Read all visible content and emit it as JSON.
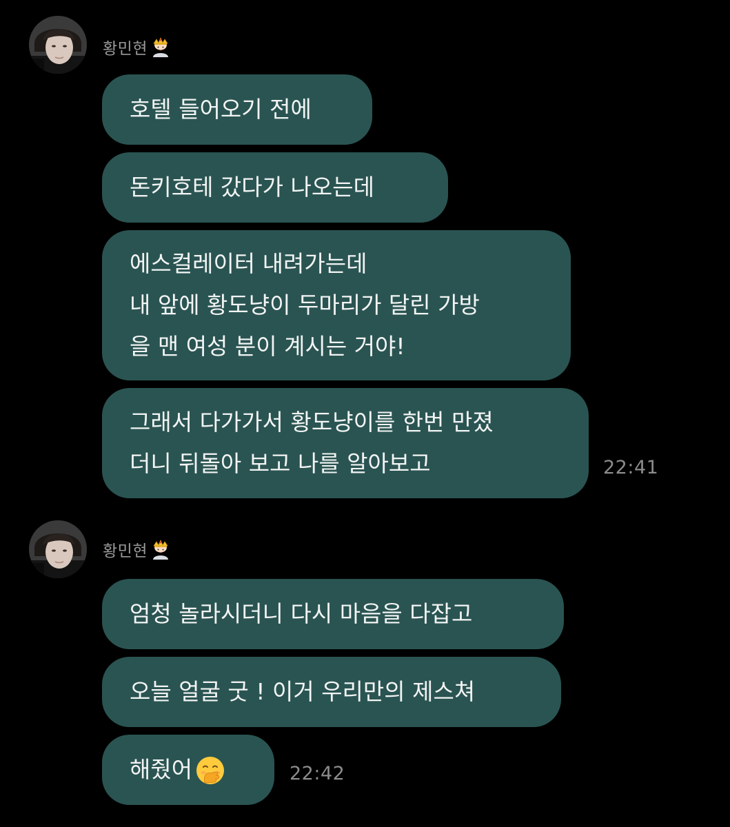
{
  "groups": [
    {
      "sender": "황민현",
      "messages": [
        {
          "lines": [
            "호텔 들어오기 전에"
          ]
        },
        {
          "lines": [
            "돈키호테 갔다가 나오는데"
          ]
        },
        {
          "lines": [
            "에스컬레이터 내려가는데",
            "내 앞에 황도냥이 두마리가 달린 가방",
            "을 맨 여성 분이 계시는 거야!"
          ]
        },
        {
          "lines": [
            "그래서 다가가서 황도냥이를 한번 만졌",
            "더니 뒤돌아 보고 나를 알아보고"
          ]
        }
      ],
      "time": "22:41"
    },
    {
      "sender": "황민현",
      "messages": [
        {
          "lines": [
            "엄청 놀라시더니 다시 마음을 다잡고"
          ]
        },
        {
          "lines": [
            "오늘 얼굴 굿 ! 이거 우리만의 제스쳐"
          ]
        },
        {
          "lines": [
            "해줬어"
          ]
        }
      ],
      "time": "22:42"
    }
  ],
  "icons": {
    "crown": "crown-person-emoji-icon",
    "hand_over_mouth": "face-with-hand-over-mouth-emoji-icon"
  },
  "colors": {
    "background": "#000000",
    "bubble": "#2a5452",
    "sender_text": "#9a9a9a",
    "time_text": "#8c8c8c"
  }
}
